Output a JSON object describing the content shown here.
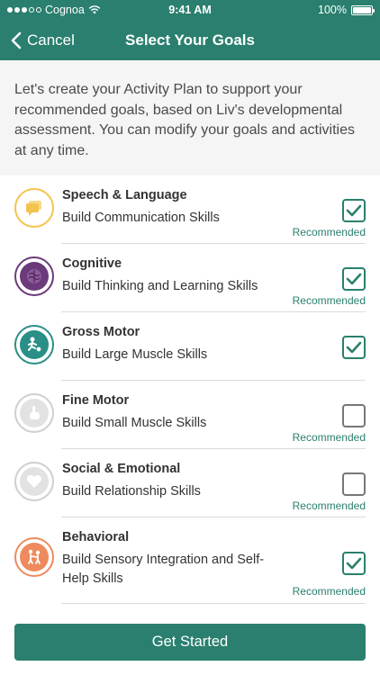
{
  "status": {
    "carrier": "Cognoa",
    "time": "9:41 AM",
    "battery": "100%",
    "battery_level": 1.0
  },
  "nav": {
    "back_label": "Cancel",
    "title": "Select Your Goals"
  },
  "intro_text": "Let's create your Activity Plan to support your recommended goals, based on Liv's developmental assessment. You can modify your goals and activities at any time.",
  "goals": [
    {
      "title": "Speech & Language",
      "subtitle": "Build Communication Skills",
      "checked": true,
      "recommended": "Recommended",
      "icon": "speech-bubble-icon",
      "color": "#f3c44d"
    },
    {
      "title": "Cognitive",
      "subtitle": "Build Thinking and Learning Skills",
      "checked": true,
      "recommended": "Recommended",
      "icon": "brain-icon",
      "color": "#6b3a7a"
    },
    {
      "title": "Gross Motor",
      "subtitle": "Build Large Muscle Skills",
      "checked": true,
      "recommended": "",
      "icon": "kicking-ball-icon",
      "color": "#2a8f86"
    },
    {
      "title": "Fine Motor",
      "subtitle": "Build Small Muscle Skills",
      "checked": false,
      "recommended": "Recommended",
      "icon": "pointing-hand-icon",
      "color": "#bdbdbd"
    },
    {
      "title": "Social & Emotional",
      "subtitle": "Build Relationship Skills",
      "checked": false,
      "recommended": "Recommended",
      "icon": "heart-icon",
      "color": "#bdbdbd"
    },
    {
      "title": "Behavioral",
      "subtitle": "Build Sensory Integration and Self-Help Skills",
      "checked": true,
      "recommended": "Recommended",
      "icon": "children-icon",
      "color": "#ee8a5e"
    }
  ],
  "cta_label": "Get Started",
  "colors": {
    "accent": "#2a7f6e",
    "background": "#ffffff",
    "intro_bg": "#f5f5f5"
  }
}
